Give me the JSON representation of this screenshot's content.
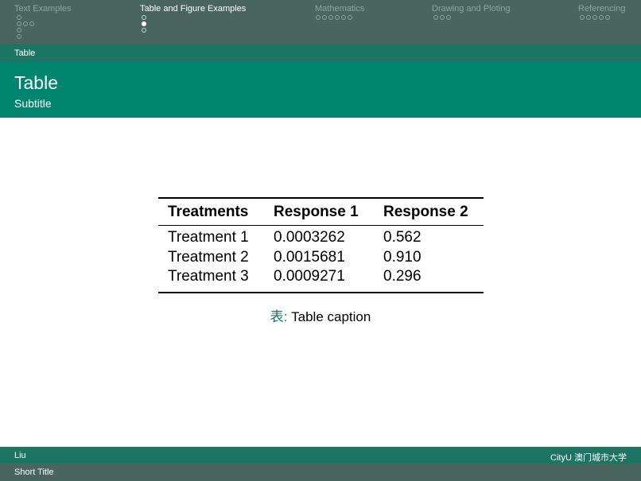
{
  "nav": {
    "sections": [
      {
        "title": "Text Examples",
        "active": false
      },
      {
        "title": "Table and Figure Examples",
        "active": true
      },
      {
        "title": "Mathematics",
        "active": false
      },
      {
        "title": "Drawing and Ploting",
        "active": false
      },
      {
        "title": "Referencing",
        "active": false
      }
    ]
  },
  "subsection": "Table",
  "frame": {
    "title": "Table",
    "subtitle": "Subtitle"
  },
  "table": {
    "headers": [
      "Treatments",
      "Response 1",
      "Response 2"
    ],
    "rows": [
      [
        "Treatment 1",
        "0.0003262",
        "0.562"
      ],
      [
        "Treatment 2",
        "0.0015681",
        "0.910"
      ],
      [
        "Treatment 3",
        "0.0009271",
        "0.296"
      ]
    ],
    "caption_label": "表:",
    "caption_text": " Table caption"
  },
  "footer": {
    "author": "Liu",
    "institute": "CityU 澳门城市大学",
    "short_title": "Short Title"
  },
  "colors": {
    "nav": "#49655e",
    "subbar": "#1c7562",
    "title": "#008570"
  }
}
